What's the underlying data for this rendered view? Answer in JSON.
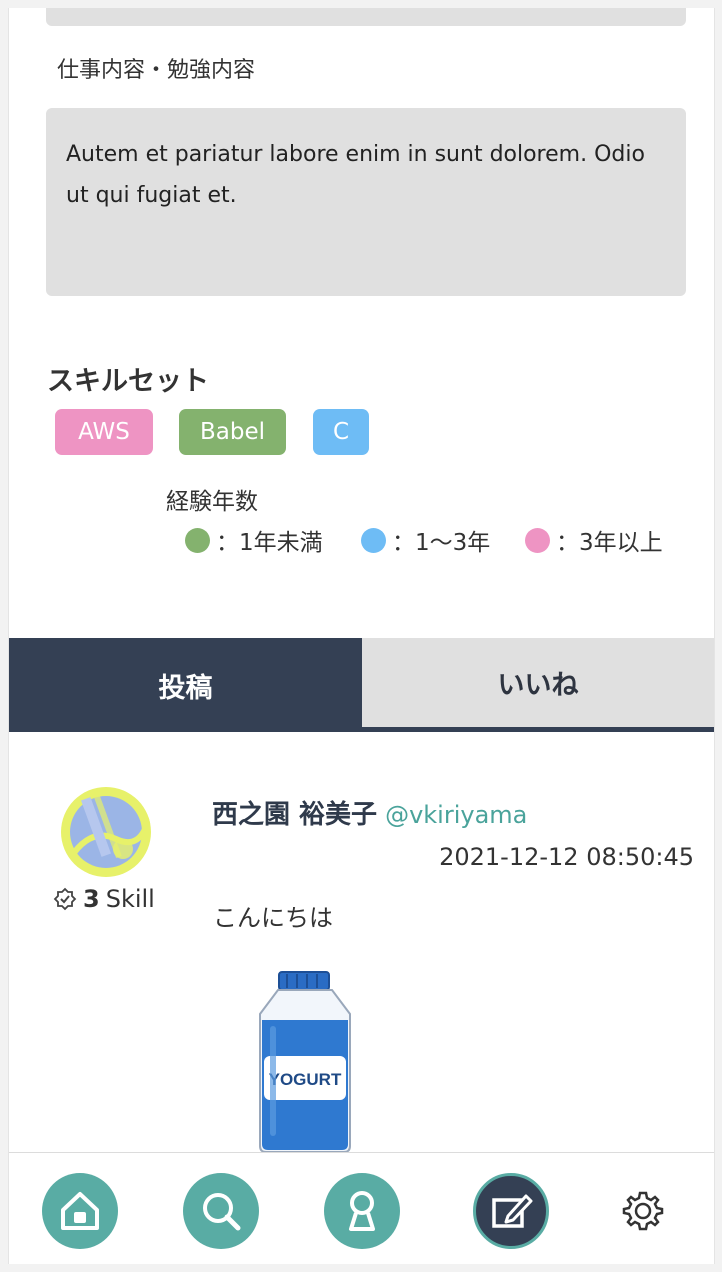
{
  "profile": {
    "work_label": "仕事内容・勉強内容",
    "work_text": "Autem et pariatur labore enim in sunt dolorem. Odio ut qui fugiat et."
  },
  "skills": {
    "heading": "スキルセット",
    "chips": [
      {
        "label": "AWS",
        "color": "#ee94c3"
      },
      {
        "label": "Babel",
        "color": "#84b26e"
      },
      {
        "label": "C",
        "color": "#6ebcf5"
      }
    ],
    "legend_title": "経験年数",
    "legend": [
      {
        "label": "：1年未満",
        "color": "#84b26e"
      },
      {
        "label": "：1〜3年",
        "color": "#6ebcf5"
      },
      {
        "label": "：3年以上",
        "color": "#ee94c3"
      }
    ]
  },
  "tabs": {
    "posts": "投稿",
    "likes": "いいね"
  },
  "post": {
    "user_name": "西之園 裕美子",
    "handle": "@vkiriyama",
    "timestamp": "2021-12-12 08:50:45",
    "body": "こんにちは",
    "skill_count": "3",
    "skill_suffix": "Skill",
    "image_label": "YOGURT"
  },
  "nav": {
    "icons": [
      "home-icon",
      "search-icon",
      "profile-icon",
      "post-edit-icon",
      "settings-icon"
    ]
  },
  "colors": {
    "accent_teal": "#59aca4",
    "navy": "#344054"
  }
}
